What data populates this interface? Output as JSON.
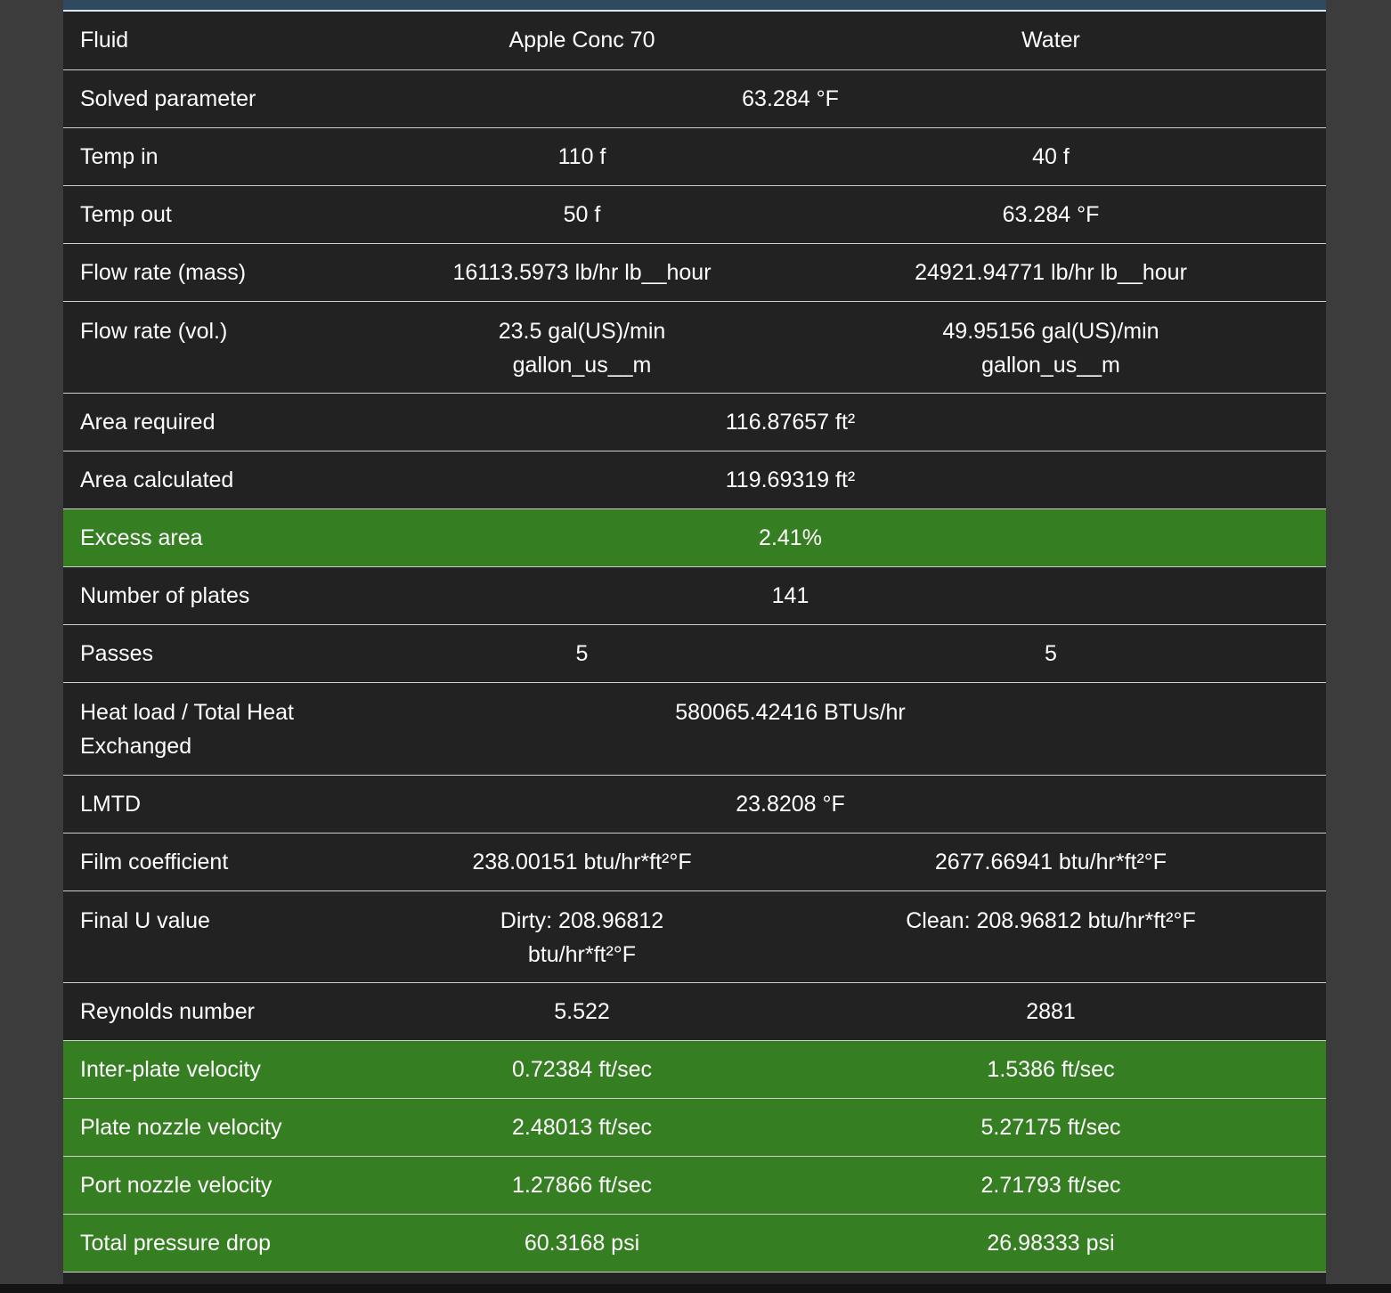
{
  "columns": {
    "hot": "Apple Conc 70",
    "cold": "Water"
  },
  "rows": {
    "fluid": {
      "label": "Fluid",
      "hot": "Apple Conc 70",
      "cold": "Water"
    },
    "solved_parameter": {
      "label": "Solved parameter",
      "value": "63.284 °F"
    },
    "temp_in": {
      "label": "Temp in",
      "hot": "110 f",
      "cold": "40 f"
    },
    "temp_out": {
      "label": "Temp out",
      "hot": "50 f",
      "cold": "63.284 °F"
    },
    "flow_mass": {
      "label": "Flow rate (mass)",
      "hot": "16113.5973 lb/hr lb__hour",
      "cold": "24921.94771 lb/hr lb__hour"
    },
    "flow_vol": {
      "label": "Flow rate (vol.)",
      "hot": "23.5 gal(US)/min gallon_us__m",
      "cold": "49.95156 gal(US)/min gallon_us__m"
    },
    "area_required": {
      "label": "Area required",
      "value": "116.87657 ft²"
    },
    "area_calculated": {
      "label": "Area calculated",
      "value": "119.69319 ft²"
    },
    "excess_area": {
      "label": "Excess area",
      "value": "2.41%"
    },
    "number_of_plates": {
      "label": "Number of plates",
      "value": "141"
    },
    "passes": {
      "label": "Passes",
      "hot": "5",
      "cold": "5"
    },
    "heat_load": {
      "label": "Heat load / Total Heat Exchanged",
      "value": "580065.42416 BTUs/hr"
    },
    "lmtd": {
      "label": "LMTD",
      "value": "23.8208 °F"
    },
    "film_coefficient": {
      "label": "Film coefficient",
      "hot": "238.00151 btu/hr*ft²°F",
      "cold": "2677.66941 btu/hr*ft²°F"
    },
    "final_u": {
      "label": "Final U value",
      "hot": "Dirty: 208.96812 btu/hr*ft²°F",
      "cold": "Clean: 208.96812 btu/hr*ft²°F"
    },
    "reynolds": {
      "label": "Reynolds number",
      "hot": "5.522",
      "cold": "2881"
    },
    "inter_plate_velocity": {
      "label": "Inter-plate velocity",
      "hot": "0.72384 ft/sec",
      "cold": "1.5386 ft/sec"
    },
    "plate_nozzle_velocity": {
      "label": "Plate nozzle velocity",
      "hot": "2.48013 ft/sec",
      "cold": "5.27175 ft/sec"
    },
    "port_nozzle_velocity": {
      "label": "Port nozzle velocity",
      "hot": "1.27866 ft/sec",
      "cold": "2.71793 ft/sec"
    },
    "total_pressure_drop": {
      "label": "Total pressure drop",
      "hot": "60.3168 psi",
      "cold": "26.98333 psi"
    }
  },
  "colors": {
    "background": "#3c3c3c",
    "panel": "#222222",
    "highlight_green": "#367e22",
    "header_accent": "#2f4a5e",
    "text": "#ffffff"
  }
}
